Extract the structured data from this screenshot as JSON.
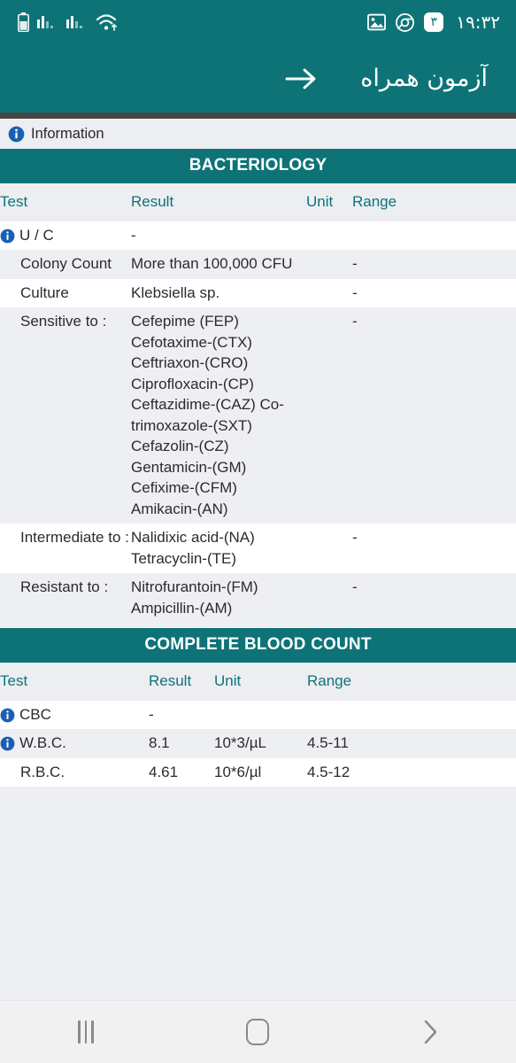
{
  "statusbar": {
    "time": "۱۹:۳۲",
    "notification_count": "۳",
    "icons": [
      "battery-icon",
      "signal-sim1-icon",
      "signal-sim2-icon",
      "wifi-icon",
      "image-icon",
      "chrome-icon",
      "notification-count-badge"
    ]
  },
  "appbar": {
    "title": "آزمون همراه",
    "back_arrow": "arrow-right-icon"
  },
  "infobar": {
    "label": "Information",
    "icon": "info-icon"
  },
  "colors": {
    "accent_teal": "#0d7377",
    "info_blue": "#1a5fb4",
    "row_alt": "#eeeff2",
    "row_white": "#ffffff",
    "dark_strip": "#464646",
    "text": "#2b2b2b"
  },
  "sections": [
    {
      "title": "BACTERIOLOGY",
      "columns": [
        "Test",
        "Result",
        "Unit",
        "Range"
      ],
      "rows": [
        {
          "test": "U / C",
          "result": "-",
          "unit": "",
          "range": "",
          "info": true,
          "indent": false,
          "shade": "white"
        },
        {
          "test": "Colony Count",
          "result": "More than 100,000 CFU",
          "unit": "",
          "range": "-",
          "info": false,
          "indent": true,
          "shade": "alt"
        },
        {
          "test": "Culture",
          "result": "Klebsiella sp.",
          "unit": "",
          "range": "-",
          "info": false,
          "indent": true,
          "shade": "white"
        },
        {
          "test": "Sensitive to :",
          "result": "Cefepime (FEP) Cefotaxime-(CTX) Ceftriaxon-(CRO) Ciprofloxacin-(CP) Ceftazidime-(CAZ) Co-trimoxazole-(SXT) Cefazolin-(CZ) Gentamicin-(GM) Cefixime-(CFM) Amikacin-(AN)",
          "unit": "",
          "range": "-",
          "info": false,
          "indent": true,
          "shade": "alt"
        },
        {
          "test": "Intermediate to :",
          "result": "Nalidixic acid-(NA) Tetracyclin-(TE)",
          "unit": "",
          "range": "-",
          "info": false,
          "indent": true,
          "shade": "white"
        },
        {
          "test": "Resistant to :",
          "result": "Nitrofurantoin-(FM) Ampicillin-(AM)",
          "unit": "",
          "range": "-",
          "info": false,
          "indent": true,
          "shade": "alt"
        }
      ]
    },
    {
      "title": "COMPLETE BLOOD COUNT",
      "columns": [
        "Test",
        "Result",
        "Unit",
        "Range"
      ],
      "rows": [
        {
          "test": "CBC",
          "result": "-",
          "unit": "",
          "range": "",
          "info": true,
          "indent": false,
          "shade": "white"
        },
        {
          "test": "W.B.C.",
          "result": "8.1",
          "unit": "10*3/µL",
          "range": "4.5-11",
          "info": true,
          "indent": false,
          "shade": "alt"
        },
        {
          "test": "R.B.C.",
          "result": "4.61",
          "unit": "10*6/µl",
          "range": "4.5-12",
          "info": false,
          "indent": true,
          "shade": "white"
        }
      ]
    }
  ],
  "navbar": {
    "recents_label": "recents-icon",
    "home_label": "home-icon",
    "back_label": "back-chevron-icon"
  }
}
